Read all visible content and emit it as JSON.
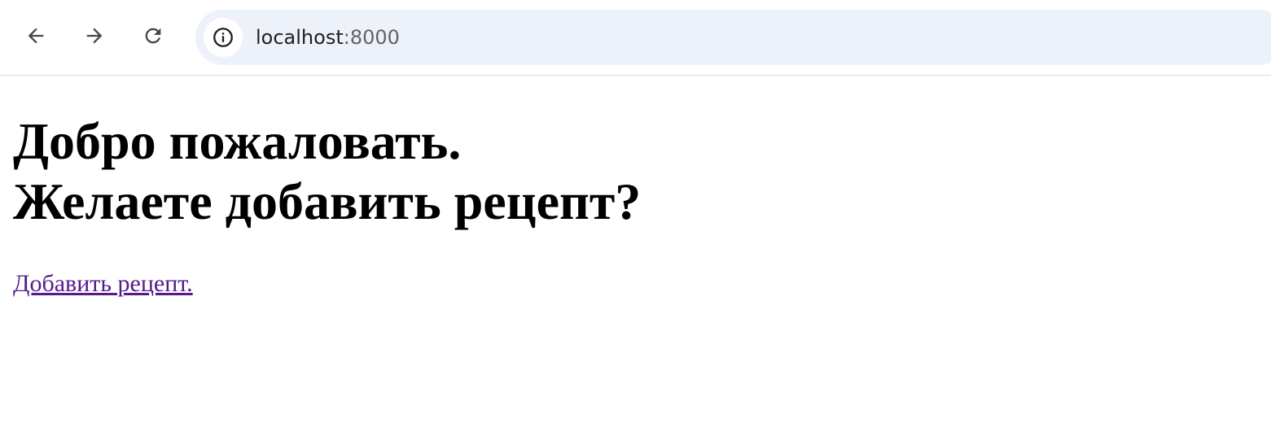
{
  "browser": {
    "url_host": "localhost",
    "url_port": ":8000",
    "icons": {
      "back": "arrow-left-icon",
      "forward": "arrow-right-icon",
      "reload": "reload-icon",
      "site_info": "info-icon"
    }
  },
  "page": {
    "heading_line1": "Добро пожаловать.",
    "heading_line2": "Желаете добавить рецепт?",
    "add_link": "Добавить рецепт."
  },
  "colors": {
    "visited_link": "#551a8b",
    "omnibox_bg": "#edf2fa"
  }
}
